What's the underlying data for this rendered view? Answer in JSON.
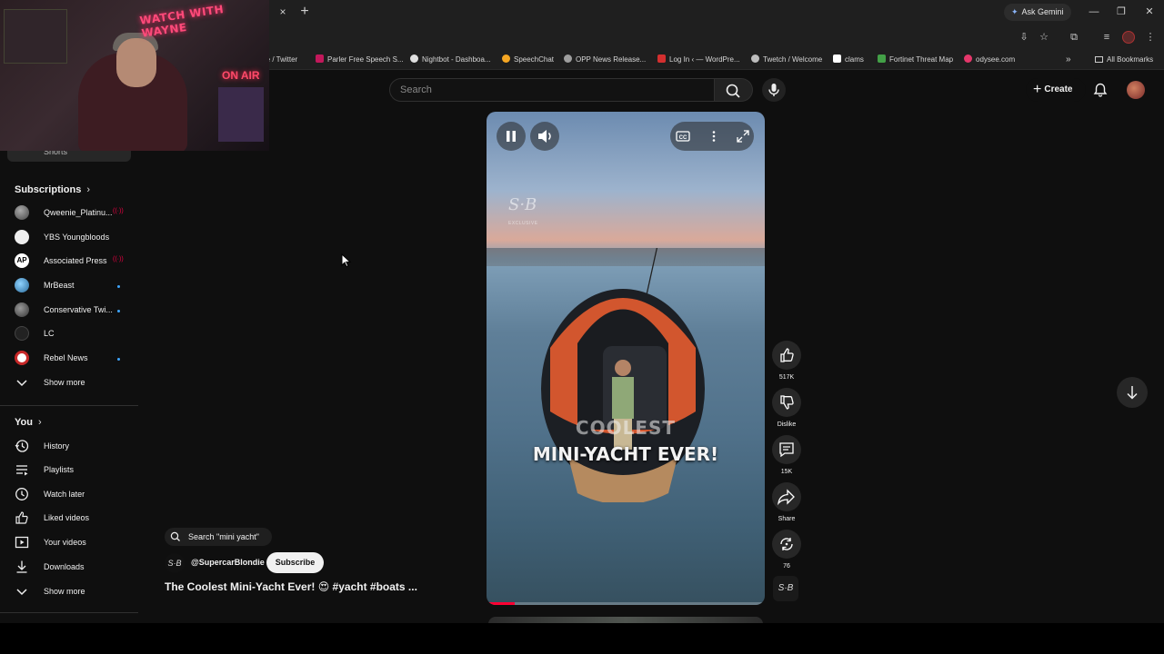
{
  "browser": {
    "tab_close": "×",
    "tab_new": "+",
    "ask_gemini": "Ask Gemini",
    "bookmarks": [
      {
        "label": "me / Twitter",
        "color": "#1d1d1d"
      },
      {
        "label": "Parler Free Speech S...",
        "color": "#c2185b"
      },
      {
        "label": "Nightbot - Dashboa...",
        "color": "#e0e0e0"
      },
      {
        "label": "SpeechChat",
        "color": "#f5a623"
      },
      {
        "label": "OPP News Release...",
        "color": "#9e9e9e"
      },
      {
        "label": "Log In ‹ — WordPre...",
        "color": "#d32f2f"
      },
      {
        "label": "Twetch / Welcome",
        "color": "#bdbdbd"
      },
      {
        "label": "clams",
        "color": "#ffffff"
      },
      {
        "label": "Fortinet Threat Map",
        "color": "#43a047"
      },
      {
        "label": "odysee.com",
        "color": "#e5376b"
      }
    ],
    "bookmarks_more": "»",
    "all_bookmarks": "All Bookmarks"
  },
  "webcam": {
    "sign_top": "WATCH WITH WAYNE",
    "sign_air": "ON AIR"
  },
  "header": {
    "search_placeholder": "Search",
    "create_label": "Create"
  },
  "sidebar": {
    "shorts_label": "Shorts",
    "subscriptions_title": "Subscriptions",
    "subscriptions": [
      {
        "name": "Qweenie_Platinu...",
        "status": "live"
      },
      {
        "name": "YBS Youngbloods",
        "status": ""
      },
      {
        "name": "Associated Press",
        "status": "live"
      },
      {
        "name": "MrBeast",
        "status": "new"
      },
      {
        "name": "Conservative Twi...",
        "status": "new"
      },
      {
        "name": "LC",
        "status": ""
      },
      {
        "name": "Rebel News",
        "status": "new"
      }
    ],
    "live_glyph": "((·))",
    "show_more_1": "Show more",
    "you_title": "You",
    "you_items": [
      {
        "label": "History",
        "icon": "history-icon"
      },
      {
        "label": "Playlists",
        "icon": "playlists-icon"
      },
      {
        "label": "Watch later",
        "icon": "watch-later-icon"
      },
      {
        "label": "Liked videos",
        "icon": "liked-icon"
      },
      {
        "label": "Your videos",
        "icon": "your-videos-icon"
      },
      {
        "label": "Downloads",
        "icon": "downloads-icon"
      }
    ],
    "show_more_2": "Show more"
  },
  "short": {
    "search_chip": "Search \"mini yacht\"",
    "channel_logo": "S·B",
    "channel": "@SupercarBlondie",
    "subscribe": "Subscribe",
    "title": "The Coolest Mini-Yacht Ever! 😍 #yacht #boats ...",
    "watermark": "S·B",
    "watermark_sub": "EXCLUSIVE",
    "caption_line1": "COOLEST",
    "caption_line2": "MINI-YACHT EVER!",
    "progress": 0.1
  },
  "actions": {
    "likes": "517K",
    "dislike": "Dislike",
    "comments": "15K",
    "share": "Share",
    "remix": "76",
    "logo": "S·B"
  },
  "colors": {
    "accent": "#ff0033",
    "live": "#ee0044",
    "new_dot": "#3ea6ff"
  }
}
